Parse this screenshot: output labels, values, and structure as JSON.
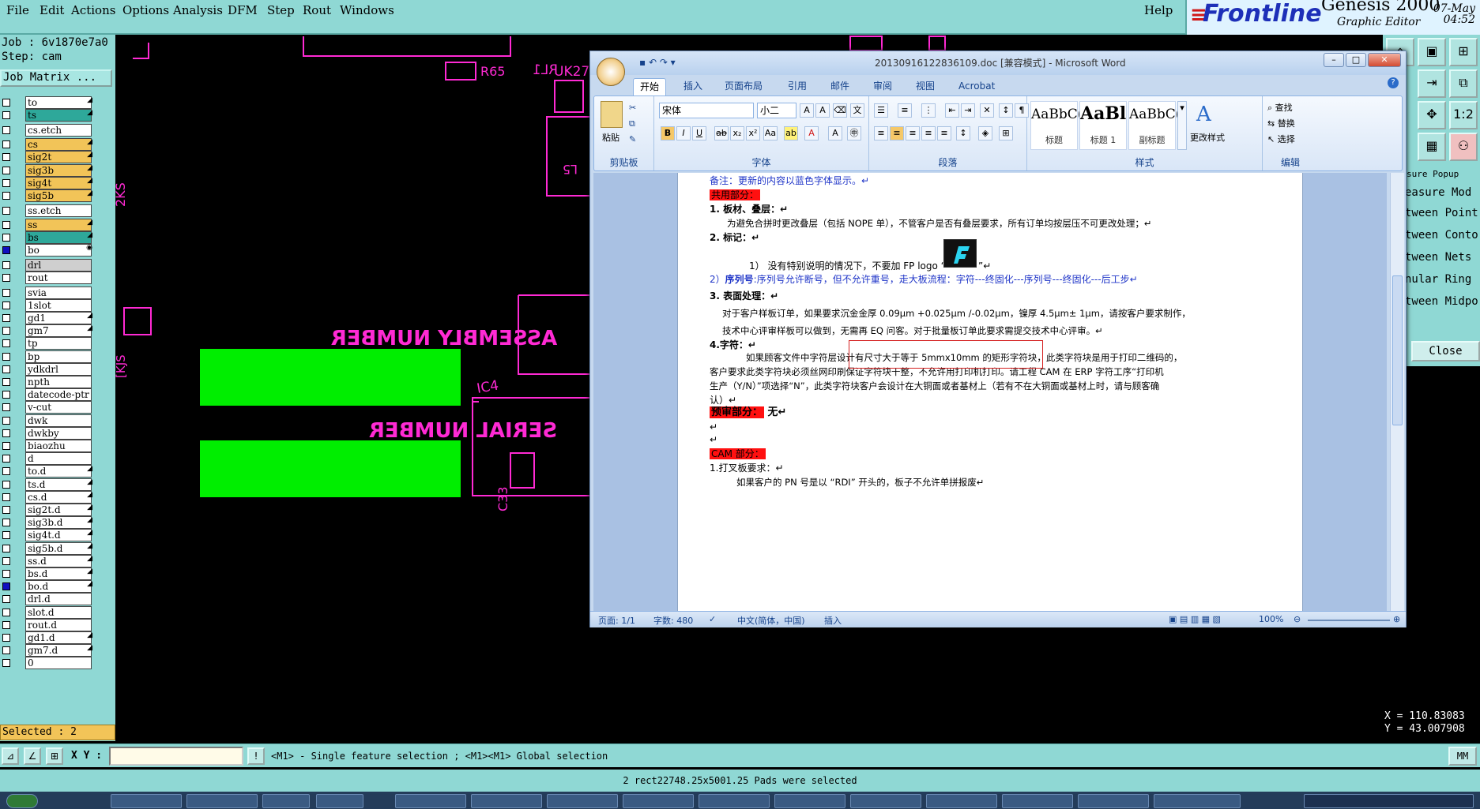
{
  "menubar": {
    "items": [
      "File",
      "Edit",
      "Actions",
      "Options",
      "Analysis",
      "DFM",
      "Step",
      "Rout",
      "Windows"
    ],
    "help": "Help"
  },
  "brand": {
    "logo": "Frontline",
    "product": "Genesis 2000",
    "subtitle": "Graphic Editor",
    "date": "07-May",
    "time": "04:52"
  },
  "job": {
    "job_line": "Job : 6v1870e7a0",
    "step_line": "Step: cam",
    "matrix_button": "Job Matrix ...",
    "selected": "Selected : 2"
  },
  "layers": [
    {
      "name": "to",
      "color": "#ffffff",
      "mark": "◢"
    },
    {
      "name": "ts",
      "color": "#2ea89a",
      "mark": "◢"
    },
    {
      "name": "cs.etch",
      "color": "#ffffff",
      "mark": ""
    },
    {
      "name": "cs",
      "color": "#f2c458",
      "mark": "◢"
    },
    {
      "name": "sig2t",
      "color": "#f2c458",
      "mark": "◢"
    },
    {
      "name": "sig3b",
      "color": "#f2c458",
      "mark": "◢"
    },
    {
      "name": "sig4t",
      "color": "#f2c458",
      "mark": "◢"
    },
    {
      "name": "sig5b",
      "color": "#f2c458",
      "mark": "◢"
    },
    {
      "name": "ss.etch",
      "color": "#ffffff",
      "mark": ""
    },
    {
      "name": "ss",
      "color": "#f2c458",
      "mark": "◢"
    },
    {
      "name": "bs",
      "color": "#2ea89a",
      "mark": "◢"
    },
    {
      "name": "bo",
      "color": "#ffffff",
      "mark": "◉"
    },
    {
      "name": "drl",
      "color": "#cfcfcf",
      "mark": ""
    },
    {
      "name": "rout",
      "color": "#ffffff",
      "mark": ""
    },
    {
      "name": "svia",
      "color": "#ffffff",
      "mark": ""
    },
    {
      "name": "1slot",
      "color": "#ffffff",
      "mark": ""
    },
    {
      "name": "gd1",
      "color": "#ffffff",
      "mark": "◢"
    },
    {
      "name": "gm7",
      "color": "#ffffff",
      "mark": "◢"
    },
    {
      "name": "tp",
      "color": "#ffffff",
      "mark": ""
    },
    {
      "name": "bp",
      "color": "#ffffff",
      "mark": ""
    },
    {
      "name": "ydkdrl",
      "color": "#ffffff",
      "mark": ""
    },
    {
      "name": "npth",
      "color": "#ffffff",
      "mark": ""
    },
    {
      "name": "datecode-ptr",
      "color": "#ffffff",
      "mark": ""
    },
    {
      "name": "v-cut",
      "color": "#ffffff",
      "mark": ""
    },
    {
      "name": "dwk",
      "color": "#ffffff",
      "mark": ""
    },
    {
      "name": "dwkby",
      "color": "#ffffff",
      "mark": ""
    },
    {
      "name": "biaozhu",
      "color": "#ffffff",
      "mark": ""
    },
    {
      "name": "d",
      "color": "#ffffff",
      "mark": ""
    },
    {
      "name": "to.d",
      "color": "#ffffff",
      "mark": "◢"
    },
    {
      "name": "ts.d",
      "color": "#ffffff",
      "mark": "◢"
    },
    {
      "name": "cs.d",
      "color": "#ffffff",
      "mark": "◢"
    },
    {
      "name": "sig2t.d",
      "color": "#ffffff",
      "mark": "◢"
    },
    {
      "name": "sig3b.d",
      "color": "#ffffff",
      "mark": "◢"
    },
    {
      "name": "sig4t.d",
      "color": "#ffffff",
      "mark": "◢"
    },
    {
      "name": "sig5b.d",
      "color": "#ffffff",
      "mark": "◢"
    },
    {
      "name": "ss.d",
      "color": "#ffffff",
      "mark": "◢"
    },
    {
      "name": "bs.d",
      "color": "#ffffff",
      "mark": "◢"
    },
    {
      "name": "bo.d",
      "color": "#ffffff",
      "mark": "◢"
    },
    {
      "name": "drl.d",
      "color": "#ffffff",
      "mark": ""
    },
    {
      "name": "slot.d",
      "color": "#ffffff",
      "mark": ""
    },
    {
      "name": "rout.d",
      "color": "#ffffff",
      "mark": ""
    },
    {
      "name": "gd1.d",
      "color": "#ffffff",
      "mark": "◢"
    },
    {
      "name": "gm7.d",
      "color": "#ffffff",
      "mark": "◢"
    },
    {
      "name": "0",
      "color": "#ffffff",
      "mark": ""
    }
  ],
  "canvas": {
    "labels": [
      "ASSEMBLY NUMBER",
      "SERIAL NUMBER",
      "RL1",
      "R65",
      "UK27",
      "L5",
      "2KS",
      "[KJS",
      "IC4",
      "C33"
    ],
    "magenta": "#ff2ad4",
    "green": "#00ee00"
  },
  "measure": {
    "header": "sure Popup",
    "options": [
      "easure Mod",
      "tween Point",
      "tween Conto",
      "tween Nets",
      "nular Ring",
      "tween Midpo"
    ],
    "close": "Close"
  },
  "coords": {
    "x": "X = 110.83083",
    "y": "Y = 43.007908"
  },
  "cmdbar": {
    "xy_label": "X Y :",
    "xy_value": "",
    "hint": "<M1> - Single feature selection ; <M1><M1> Global selection",
    "units": "MM"
  },
  "status": "2 rect22748.25x5001.25 Pads were selected",
  "word": {
    "title": "20130916122836109.doc [兼容模式] - Microsoft Word",
    "tabs": [
      "开始",
      "插入",
      "页面布局",
      "引用",
      "邮件",
      "审阅",
      "视图",
      "Acrobat"
    ],
    "clipboard_label": "剪贴板",
    "paste": "粘贴",
    "font_label": "字体",
    "font_name": "宋体",
    "font_size": "小二",
    "paragraph_label": "段落",
    "styles_label": "样式",
    "styles": [
      {
        "preview": "AaBbC(",
        "name": "标题"
      },
      {
        "preview": "AaBl",
        "name": "标题 1"
      },
      {
        "preview": "AaBbC(",
        "name": "副标题"
      }
    ],
    "change_styles": "更改样式",
    "editing_label": "编辑",
    "find": "查找",
    "replace": "替换",
    "select": "选择",
    "statusbar": {
      "page": "页面: 1/1",
      "words": "字数: 480",
      "lang": "中文(简体，中国)",
      "mode": "插入",
      "zoom": "100%"
    },
    "doc": {
      "note": "备注：更新的内容以蓝色字体显示。↵",
      "common": "共用部分：",
      "h1": "1.  板材、叠层：↵",
      "p1": "为避免合拼时更改叠层（包括 NOPE 单），不管客户是否有叠层要求，所有订单均按层压不可更改处理；↵",
      "h2": "2. 标记：↵",
      "p2": "1）  没有特别说明的情况下，不要加 FP logo “",
      "p2b": "”↵",
      "p3a": "2）",
      "p3b": "序列号",
      "p3c": ":序列号允许断号，但不允许重号，走大板流程：字符---终固化---序列号---终固化---后工步↵",
      "h3": "3. 表面处理：↵",
      "p4": "对于客户样板订单，如果要求沉金金厚 0.09μm +0.025μm /-0.02μm，镍厚 4.5μm± 1μm，请按客户要求制作，",
      "p5": "技术中心评审样板可以做到，无需再 EQ 问客。对于批量板订单此要求需提交技术中心评审。↵",
      "h4": "4.字符：↵",
      "p6": "如果顾客文件中字符层设计有尺寸大于等于 5mmx10mm 的矩形字符块，此类字符块是用于打印二维码的，",
      "p7": "客户要求此类字符块必须丝网印刷保证字符块干整，不允许用打印机打印。请工程 CAM 在 ERP 字符工序“打印机",
      "p8": "生产（Y/N）”项选择“N”，此类字符块客户会设计在大铜面或者基材上（若有不在大铜面或基材上时，请与顾客确",
      "p9": "认）↵",
      "precheck": "预审部分：",
      "precheck_val": "无↵",
      "blank1": "↵",
      "blank2": "↵",
      "cam": "CAM 部分：",
      "h5": "1.打叉板要求：↵",
      "p10": "如果客户的 PN 号是以 “RDI” 开头的，板子不允许单拼报废↵"
    }
  }
}
